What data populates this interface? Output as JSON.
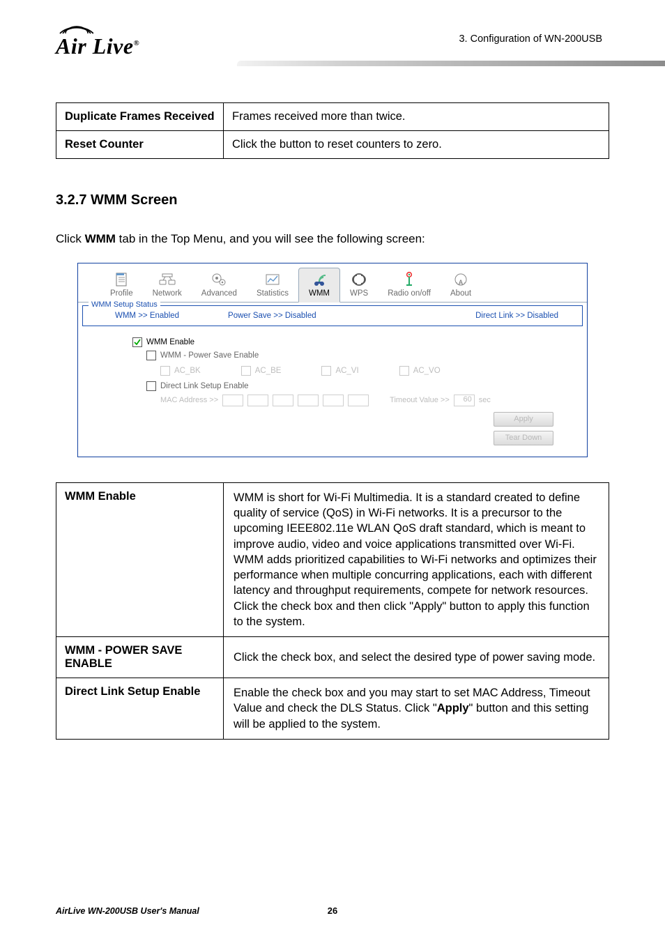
{
  "header": {
    "section_label": "3.  Configuration  of  WN-200USB",
    "logo_text": "Air Live",
    "logo_reg": "®"
  },
  "param_table": {
    "rows": [
      {
        "key": "Duplicate Frames Received",
        "val": "Frames received more than twice."
      },
      {
        "key": "Reset Counter",
        "val": "Click the button to reset counters to zero."
      }
    ]
  },
  "section_title": "3.2.7 WMM Screen",
  "intro_pre": "Click ",
  "intro_bold": "WMM",
  "intro_post": " tab in the Top Menu, and you will see the following screen:",
  "app": {
    "tabs": [
      "Profile",
      "Network",
      "Advanced",
      "Statistics",
      "WMM",
      "WPS",
      "Radio on/off",
      "About"
    ],
    "active_tab_index": 4,
    "status_legend": "WMM Setup Status",
    "status": {
      "wmm": "WMM >> Enabled",
      "power": "Power Save >> Disabled",
      "dls": "Direct Link >> Disabled"
    },
    "cb": {
      "wmm_enable": "WMM Enable",
      "power_save": "WMM - Power Save Enable",
      "types": [
        "AC_BK",
        "AC_BE",
        "AC_VI",
        "AC_VO"
      ],
      "dls_enable": "Direct Link Setup Enable",
      "mac_label": "MAC Address >>",
      "timeout_label": "Timeout Value >>",
      "timeout_value": "60",
      "timeout_unit": "sec"
    },
    "buttons": {
      "apply": "Apply",
      "tear": "Tear Down"
    }
  },
  "defs": {
    "rows": [
      {
        "key": "WMM Enable",
        "val": "WMM is short for Wi-Fi Multimedia. It is a standard created to define quality of service (QoS) in Wi-Fi networks. It is a precursor to the upcoming IEEE802.11e WLAN QoS draft standard, which is meant to improve audio, video and voice applications transmitted over Wi-Fi. WMM adds prioritized capabilities to Wi-Fi networks and optimizes their performance when multiple concurring applications, each with different latency and throughput requirements, compete for network resources. Click the check box and then click \"Apply\" button to apply this function to the system."
      },
      {
        "key": "WMM - POWER SAVE ENABLE",
        "val": "Click the check box, and select the desired type of power saving mode."
      },
      {
        "key": "Direct Link Setup Enable",
        "val_pre": "Enable the check box and you may start to set MAC Address, Timeout Value and check the DLS Status. Click \"",
        "val_bold": "Apply",
        "val_post": "\" button and this setting will be applied to the system."
      }
    ]
  },
  "footer": {
    "manual": "AirLive WN-200USB User's Manual",
    "page": "26"
  }
}
